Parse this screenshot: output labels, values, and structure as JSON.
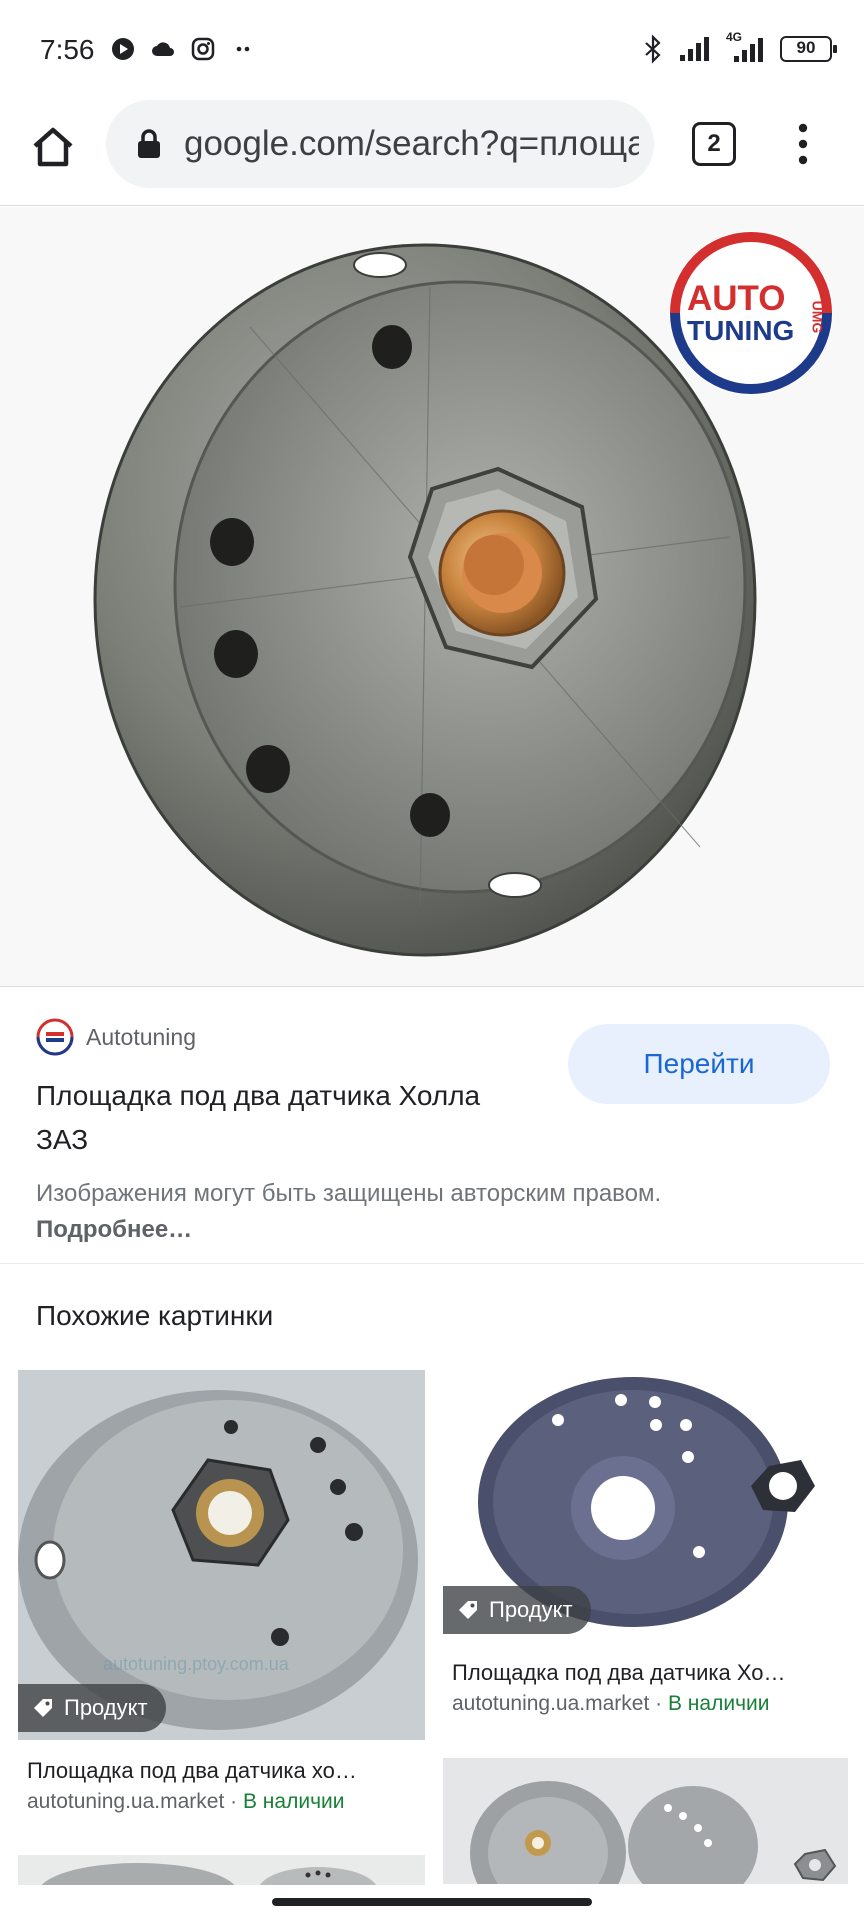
{
  "status_bar": {
    "time": "7:56",
    "battery": "90",
    "network": "4G"
  },
  "browser": {
    "url": "google.com/search?q=площадка под два датчика холла заз",
    "tab_count": "2"
  },
  "result": {
    "site_name": "Autotuning",
    "title": "Площадка под два датчика Холла ЗАЗ",
    "go_button": "Перейти",
    "copyright_text": "Изображения могут быть защищены авторским правом. ",
    "copyright_link": "Подробнее…"
  },
  "watermark": {
    "line1": "AUTO",
    "line2": "TUNING",
    "side": "UMG"
  },
  "similar": {
    "heading": "Похожие картинки",
    "items": [
      {
        "chip": "Продукт",
        "title": "Площадка под два датчика хо…",
        "source": "autotuning.ua.market",
        "separator": " · ",
        "availability": "В наличии",
        "img_watermark": "autotuning.ptoy.com.ua"
      },
      {
        "chip": "Продукт",
        "title": "Площадка под два датчика Хо…",
        "source": "autotuning.ua.market",
        "separator": " · ",
        "availability": "В наличии"
      }
    ]
  },
  "colors": {
    "accent": "#1967d2",
    "button_bg": "#e8f0fe",
    "in_stock": "#188038",
    "logo_red": "#d32f2f",
    "logo_blue": "#1e3a8a"
  }
}
